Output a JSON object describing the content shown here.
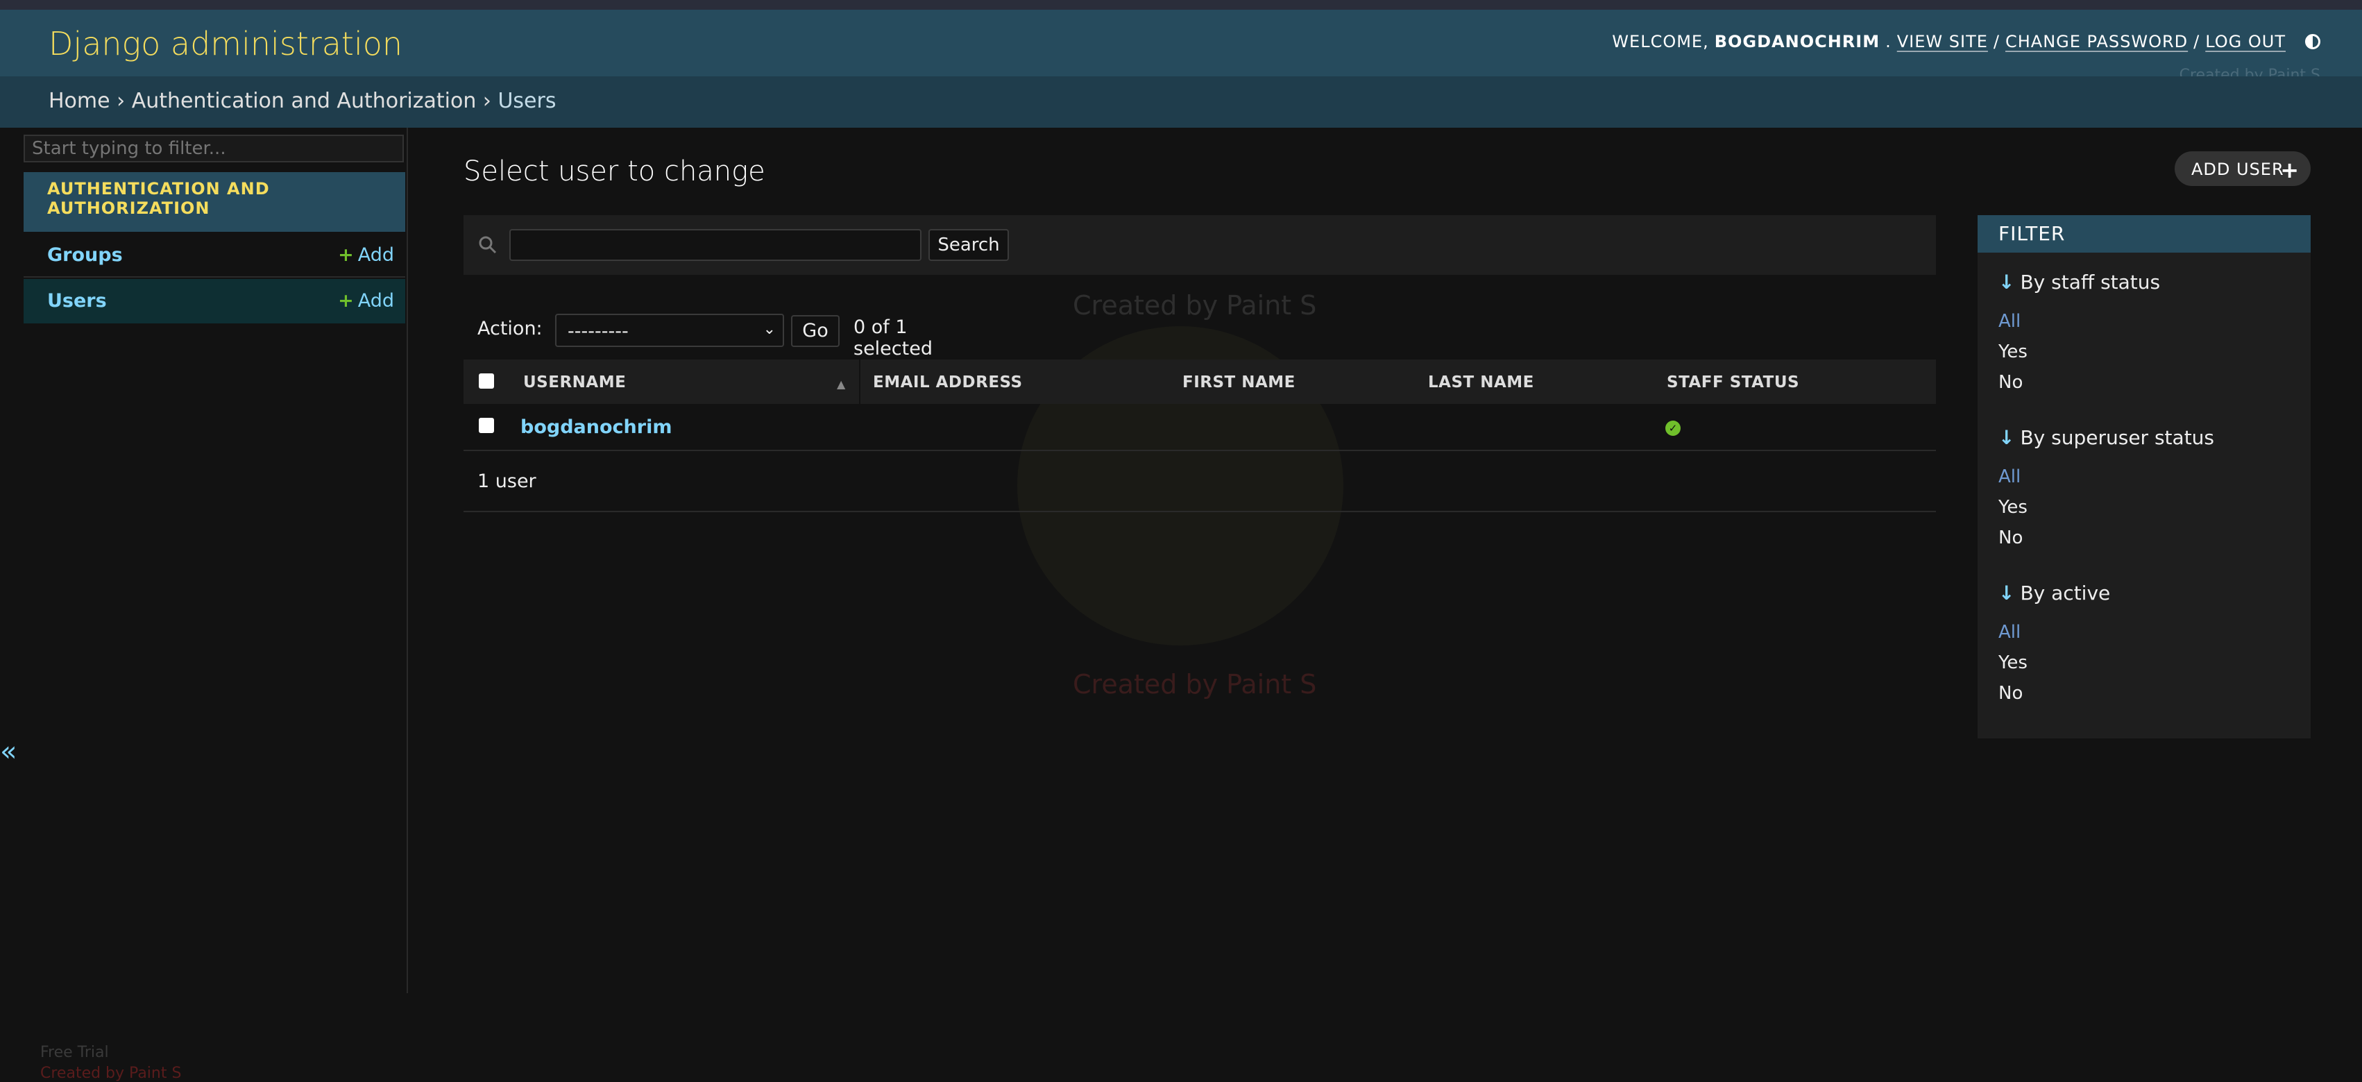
{
  "header": {
    "branding": "Django administration",
    "welcome": "WELCOME,",
    "username": "BOGDANOCHRIM",
    "view_site": "VIEW SITE",
    "change_password": "CHANGE PASSWORD",
    "log_out": "LOG OUT",
    "separator": "/",
    "watermark": "Created by Paint S"
  },
  "breadcrumbs": {
    "home": "Home",
    "app": "Authentication and Authorization",
    "current": "Users",
    "sep": "›"
  },
  "sidebar": {
    "filter_placeholder": "Start typing to filter...",
    "app_caption": "AUTHENTICATION AND AUTHORIZATION",
    "items": [
      {
        "label": "Groups",
        "add": "Add"
      },
      {
        "label": "Users",
        "add": "Add"
      }
    ],
    "collapse": "«",
    "watermark_1": "Free Trial",
    "watermark_2": "Created by Paint S"
  },
  "content": {
    "title": "Select user to change",
    "add_user": "ADD USER",
    "search_button": "Search",
    "action_label": "Action:",
    "action_value": "---------",
    "go": "Go",
    "counter": "0 of 1 selected",
    "columns": [
      "USERNAME",
      "EMAIL ADDRESS",
      "FIRST NAME",
      "LAST NAME",
      "STAFF STATUS"
    ],
    "rows": [
      {
        "username": "bogdanochrim",
        "email": "",
        "first_name": "",
        "last_name": "",
        "staff_status": true
      }
    ],
    "paginator": "1 user",
    "watermark": "Created by Paint S"
  },
  "filter": {
    "title": "FILTER",
    "groups": [
      {
        "title": "By staff status",
        "options": [
          "All",
          "Yes",
          "No"
        ],
        "selected": "All"
      },
      {
        "title": "By superuser status",
        "options": [
          "All",
          "Yes",
          "No"
        ],
        "selected": "All"
      },
      {
        "title": "By active",
        "options": [
          "All",
          "Yes",
          "No"
        ],
        "selected": "All"
      }
    ]
  },
  "colors": {
    "header_bg": "#264b5d",
    "branding": "#f5dd5d",
    "link": "#81d4fa",
    "add_green": "#70bf2b"
  }
}
